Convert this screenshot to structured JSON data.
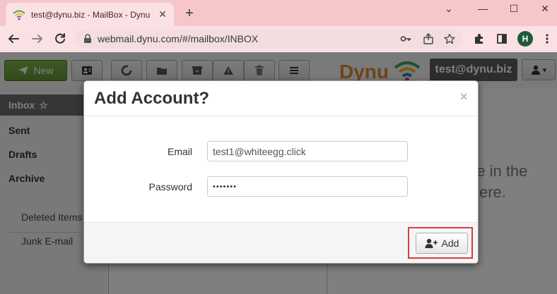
{
  "browser": {
    "tab_title": "test@dynu.biz - MailBox - Dynu W",
    "url": "webmail.dynu.com/#/mailbox/INBOX",
    "profile_initial": "H",
    "window_minimize": "⌄",
    "window_restore": "—",
    "window_maximize": "☐",
    "window_close": "✕",
    "new_tab": "+",
    "tab_close": "✕"
  },
  "app": {
    "new_button_label": "New",
    "logo_text": "Dynu",
    "user_email": "test@dynu.biz",
    "user_menu_caret": "▾"
  },
  "sidebar": {
    "inbox_label": "Inbox",
    "star_glyph": "☆",
    "items": [
      "Sent",
      "Drafts",
      "Archive"
    ],
    "sub_items": [
      "Deleted Items",
      "Junk E-mail"
    ]
  },
  "reading_pane": {
    "line1": "ge in the",
    "line2": "ere."
  },
  "modal": {
    "title": "Add Account?",
    "close_glyph": "×",
    "email_label": "Email",
    "email_value": "test1@whiteegg.click",
    "password_label": "Password",
    "password_value": "•••••••",
    "add_button_label": "Add"
  },
  "colors": {
    "tab_strip": "#f6c6cb",
    "new_button": "#6aa03c",
    "logo_orange": "#e0892e",
    "highlight": "#e03b3b"
  }
}
